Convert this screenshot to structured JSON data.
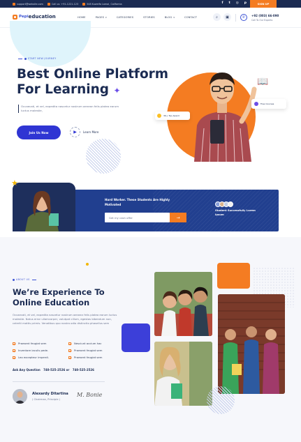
{
  "topbar": {
    "email": "support@website.com",
    "phone": "Call us: +91-1221-123",
    "address": "548 Kuweifa Lamai, California",
    "signup_label": "SIGN UP",
    "social_icons": [
      "facebook-icon",
      "twitter-icon",
      "instagram-icon",
      "pinterest-icon"
    ]
  },
  "nav": {
    "logo_prefix": "Pepi",
    "logo_text": "education",
    "menu": [
      "HOME",
      "PAGES",
      "CATEGORIES",
      "STORIES",
      "BLOG",
      "CONTACT"
    ],
    "phone": "+92 (003) 66-090",
    "phone_sub": "Call To Our Experts"
  },
  "hero": {
    "tag": "START NEW JOURNEY",
    "title_line1": "Best Online Platform",
    "title_line2": "For Learning",
    "lead": "Occaecati, et vel, expedita nascetur nostrum aenean felis platea earum luctus molestie,",
    "join_label": "Join Us Now",
    "learn_label": "Learn More",
    "badge_top": "3K+ Top Award",
    "badge_courses": "Free Courses"
  },
  "banner": {
    "title": "Hard Worker. These Students Are Highly Motivated",
    "input_placeholder": "Get my cash offer",
    "button_glyph": "→",
    "success_text": "Student Successfully Lorem Ipsum"
  },
  "about": {
    "tag": "ABOUT US",
    "title_line1": "We’re Experience To",
    "title_line2": "Online Education",
    "paragraph": "Occaecati, et vel, expedita nascetur nostrum aenean felis platea earum luctus molestie. Natus error ullamcorper, volutpat cillum, egestas bibendum non, celeriti mattis primis. Venatibus quo nostra odio distinctio phasellus sem",
    "checks": [
      "Praesent feugiat sem",
      "Nesciunt accium hac",
      "Inventore iaculis pede.",
      "Praesent feugiat sem",
      "Leo excepteur imperdi.",
      "Praesent feugiat sem"
    ],
    "ask_label": "Ask Any Question",
    "phone1": "740-525-2526",
    "or_label": "or",
    "phone2": "740-525-2526",
    "author_name": "Alexardy Ditartina",
    "author_role": "( Chairman, Principle )",
    "signature": "M. Bonie"
  }
}
